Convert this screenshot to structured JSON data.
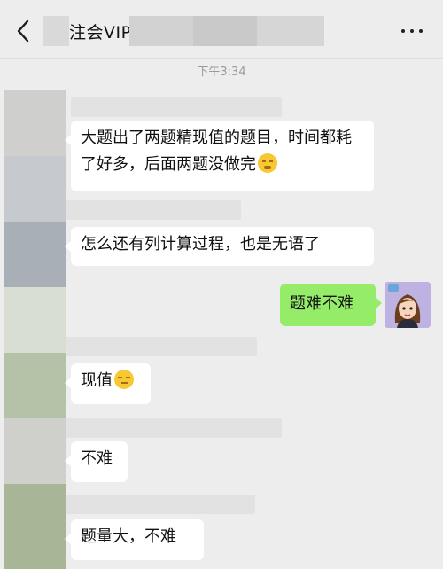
{
  "header": {
    "title": "注会VIP",
    "back_icon": "chevron-left-icon",
    "more_icon": "more-dots-icon"
  },
  "timestamp": "下午3:34",
  "messages": [
    {
      "sender": "other",
      "text": "大题出了两题精现值的题目，时间都耗了好多，后面两题没做完",
      "emoji": "crying-face-emoji"
    },
    {
      "sender": "other",
      "text": "怎么还有列计算过程，也是无语了"
    },
    {
      "sender": "me",
      "text": "题难不难"
    },
    {
      "sender": "other",
      "text": "现值",
      "emoji": "smirk-face-emoji"
    },
    {
      "sender": "other",
      "text": "不难"
    },
    {
      "sender": "other",
      "text": "题量大，不难"
    }
  ],
  "colors": {
    "background": "#ededed",
    "my_bubble": "#95ec69",
    "other_bubble": "#ffffff"
  }
}
